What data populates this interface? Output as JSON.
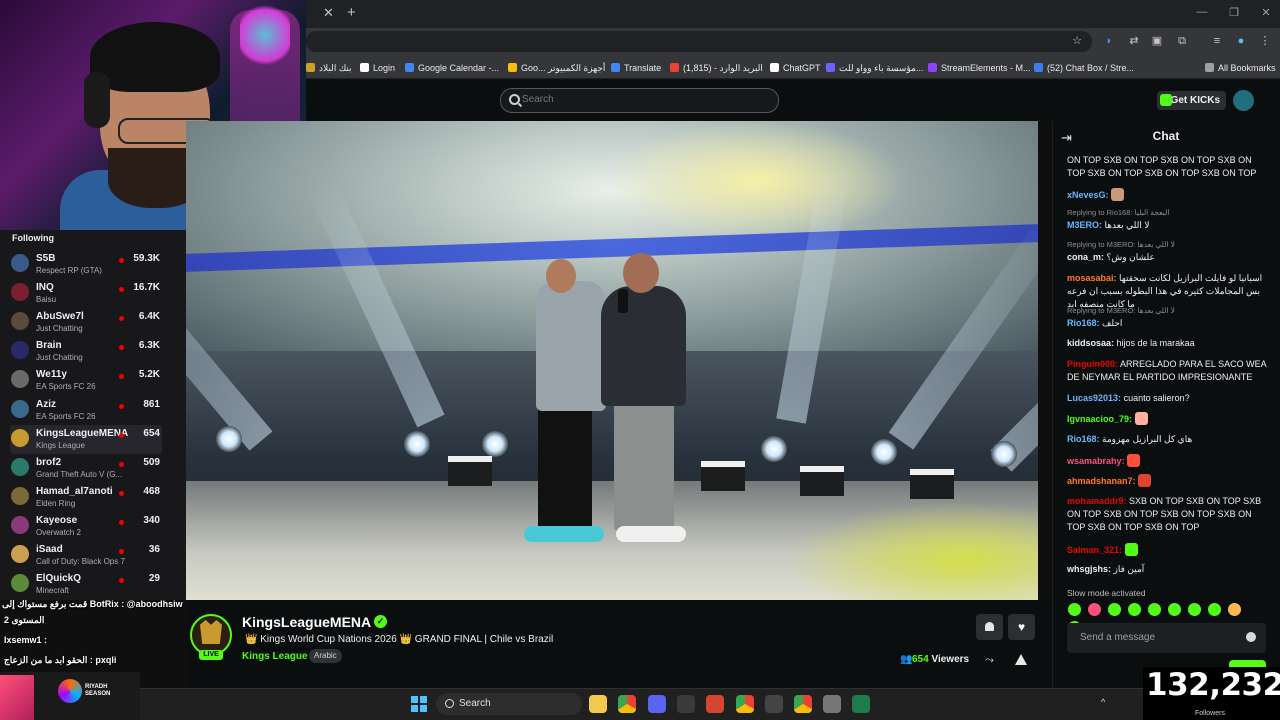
{
  "browser": {
    "bookmarks": [
      {
        "label": "بنك البلاد",
        "color": "#c9a227"
      },
      {
        "label": "Login",
        "color": "#ffffff"
      },
      {
        "label": "Google Calendar -...",
        "color": "#4285f4"
      },
      {
        "label": "Goo... أجهزة الكمبيوتر",
        "color": "#fbbc05"
      },
      {
        "label": "Translate",
        "color": "#4285f4"
      },
      {
        "label": "(1,815) - البريد الوارد",
        "color": "#ea4335"
      },
      {
        "label": "ChatGPT",
        "color": "#ffffff"
      },
      {
        "label": "مؤسسة باء وواو للت...",
        "color": "#6c63ff"
      },
      {
        "label": "StreamElements - M...",
        "color": "#8e44ff"
      },
      {
        "label": "(52) Chat Box / Stre...",
        "color": "#3d7cf0"
      },
      {
        "label": "All Bookmarks",
        "color": "#9aa0a6"
      }
    ]
  },
  "kick": {
    "search_placeholder": "Search",
    "get_kicks_label": "Get KICKs",
    "accent": "#53fc18"
  },
  "sidebar": {
    "title": "Following",
    "items": [
      {
        "name": "S5B",
        "game": "Respect RP (GTA)",
        "viewers": "59.3K",
        "avatar": "#3a5a8a"
      },
      {
        "name": "INQ",
        "game": "Baisu",
        "viewers": "16.7K",
        "avatar": "#7a2030"
      },
      {
        "name": "AbuSwe7l",
        "game": "Just Chatting",
        "viewers": "6.4K",
        "avatar": "#5a4a3a"
      },
      {
        "name": "Brain",
        "game": "Just Chatting",
        "viewers": "6.3K",
        "avatar": "#2a2a6a"
      },
      {
        "name": "We11y",
        "game": "EA Sports FC 26",
        "viewers": "5.2K",
        "avatar": "#6a6a6a"
      },
      {
        "name": "Aziz",
        "game": "EA Sports FC 26",
        "viewers": "861",
        "avatar": "#3a6a8a"
      },
      {
        "name": "KingsLeagueMENA",
        "game": "Kings League",
        "viewers": "654",
        "avatar": "#c99a2e"
      },
      {
        "name": "brof2",
        "game": "Grand Theft Auto V (G...",
        "viewers": "509",
        "avatar": "#2a7a6a"
      },
      {
        "name": "Hamad_al7anoti",
        "game": "Elden Ring",
        "viewers": "468",
        "avatar": "#7a6a3a"
      },
      {
        "name": "Kayeose",
        "game": "Overwatch 2",
        "viewers": "340",
        "avatar": "#8a3a7a"
      },
      {
        "name": "iSaad",
        "game": "Call of Duty: Black Ops 7",
        "viewers": "36",
        "avatar": "#caa050"
      },
      {
        "name": "ElQuickQ",
        "game": "Minecraft",
        "viewers": "29",
        "avatar": "#5a8a3a"
      }
    ]
  },
  "stream": {
    "channel": "KingsLeagueMENA",
    "title": "👑 Kings World Cup Nations 2026 👑 GRAND FINAL | Chile vs Brazil",
    "category": "Kings League",
    "language": "Arabic",
    "live_label": "LIVE",
    "viewers_count": "654",
    "viewers_label": "Viewers"
  },
  "overlay_chat": [
    {
      "text": "قمت برفع مستواك إلى BotRix : @aboodhsiw"
    },
    {
      "text": "المستوى 2"
    },
    {
      "text": "lxsemw1 :"
    },
    {
      "text": "الحقو ابد ما من الزعاج : pxqli"
    }
  ],
  "chat": {
    "title": "Chat",
    "messages": [
      {
        "user": "",
        "color": "#efeff1",
        "text": "ON TOP SXB ON TOP SXB ON TOP SXB ON TOP SXB ON TOP SXB ON TOP SXB ON TOP"
      },
      {
        "user": "xNevesG:",
        "color": "#6bb6ff",
        "text": ""
      },
      {
        "reply": "Replying to Rio168: البعجة البليا",
        "user": "M3ERO:",
        "color": "#6bb6ff",
        "text": "لا اللي بعدها"
      },
      {
        "reply": "Replying to M3ERO: لا اللي بعدها",
        "user": "cona_m:",
        "color": "#efeff1",
        "text": "علشان وش؟"
      },
      {
        "user": "mosasabai:",
        "color": "#ff7a2a",
        "text": "اسبانيا لو فايلت البرازيل لكانت سحقتها بس المجاملات كثيره في هذا البطوله بسبب ان فرعه ما كانت منصفه ابد"
      },
      {
        "reply": "Replying to M3ERO: لا اللي بعدها",
        "user": "Rio168:",
        "color": "#6bb6ff",
        "text": "احلف"
      },
      {
        "user": "kiddsosaa:",
        "color": "#efeff1",
        "text": "hijos de la marakaa"
      },
      {
        "user": "Pinguin000:",
        "color": "#eb0400",
        "text": "ARREGLADO PARA EL SACO WEA DE NEYMAR EL PARTIDO IMPRESIONANTE"
      },
      {
        "user": "Lucas92013:",
        "color": "#6bb6ff",
        "text": "cuanto salieron?"
      },
      {
        "user": "Igvnaacioo_79:",
        "color": "#53fc18",
        "text": ""
      },
      {
        "user": "Rio168:",
        "color": "#6bb6ff",
        "text": "هاي كل البرازيل مهزومة"
      },
      {
        "user": "wsamabrahy:",
        "color": "#ff4f7b",
        "text": ""
      },
      {
        "user": "ahmadshanan7:",
        "color": "#ff7a2a",
        "text": ""
      },
      {
        "user": "mohamaddr9:",
        "color": "#eb0400",
        "text": "SXB ON TOP SXB ON TOP SXB ON TOP SXB ON TOP SXB ON TOP SXB ON TOP SXB ON TOP SXB ON TOP"
      },
      {
        "user": "Salman_321:",
        "color": "#eb0400",
        "text": ""
      },
      {
        "user": "whsgjshs:",
        "color": "#efeff1",
        "text": "آمين فاز"
      }
    ],
    "slow_mode": "Slow mode activated",
    "send_placeholder": "Send a message"
  },
  "followers": {
    "count": "132,232",
    "label": "Followers"
  },
  "taskbar": {
    "search_label": "Search",
    "riyadh_line1": "RIYADH",
    "riyadh_line2": "SEASON"
  }
}
